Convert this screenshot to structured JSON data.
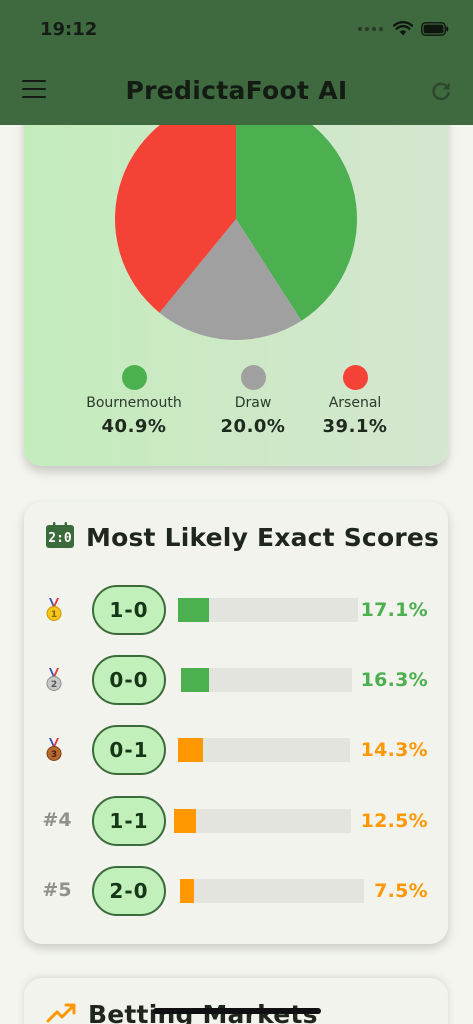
{
  "status_bar": {
    "time": "19:12"
  },
  "app_bar": {
    "title": "PredictaFoot AI",
    "menu_icon": "hamburger-menu-icon",
    "refresh_icon": "refresh-icon",
    "color": "#3f6a3f"
  },
  "probabilities": {
    "chart_data": {
      "type": "pie",
      "categories": [
        "Bournemouth",
        "Draw",
        "Arsenal"
      ],
      "values": [
        40.9,
        20.0,
        39.1
      ],
      "colors": [
        "#4caf50",
        "#a0a0a0",
        "#f44336"
      ]
    },
    "legend": [
      {
        "name": "Bournemouth",
        "value": "40.9%",
        "color": "#4caf50"
      },
      {
        "name": "Draw",
        "value": "20.0%",
        "color": "#a0a0a0"
      },
      {
        "name": "Arsenal",
        "value": "39.1%",
        "color": "#f44336"
      }
    ]
  },
  "exact_scores": {
    "title": "Most Likely Exact Scores",
    "icon": "scoreboard-icon",
    "rows": [
      {
        "rank": "",
        "medal": "gold-medal-icon",
        "score": "1-0",
        "percent": "17.1%",
        "value": 17.1,
        "color": "#4caf50"
      },
      {
        "rank": "",
        "medal": "silver-medal-icon",
        "score": "0-0",
        "percent": "16.3%",
        "value": 16.3,
        "color": "#4caf50"
      },
      {
        "rank": "",
        "medal": "bronze-medal-icon",
        "score": "0-1",
        "percent": "14.3%",
        "value": 14.3,
        "color": "#ff9800"
      },
      {
        "rank": "#4",
        "medal": "",
        "score": "1-1",
        "percent": "12.5%",
        "value": 12.5,
        "color": "#ff9800"
      },
      {
        "rank": "#5",
        "medal": "",
        "score": "2-0",
        "percent": "7.5%",
        "value": 7.5,
        "color": "#ff9800"
      }
    ]
  },
  "betting_markets": {
    "title": "Betting Markets",
    "icon": "trending-up-icon"
  }
}
